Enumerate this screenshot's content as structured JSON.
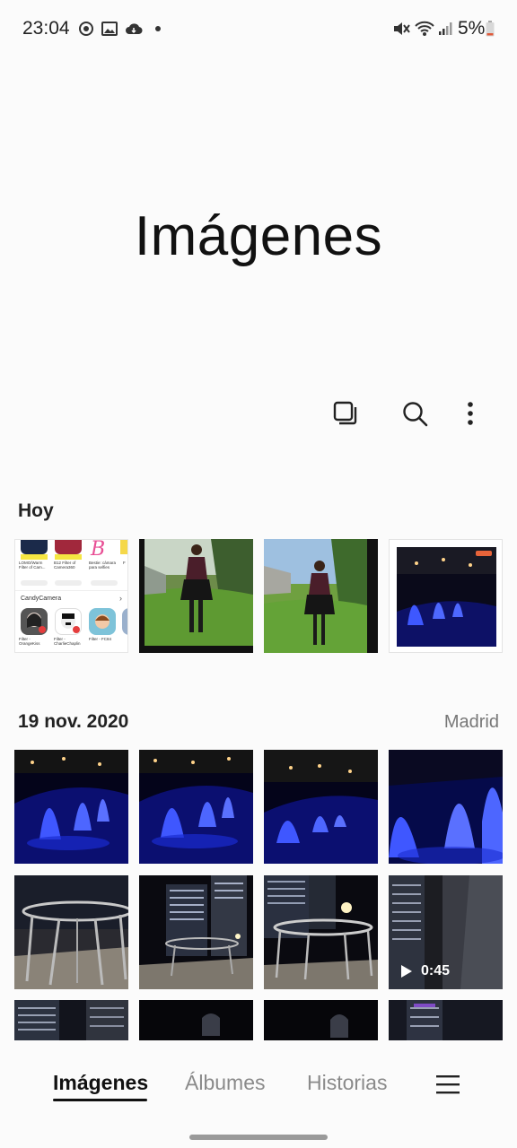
{
  "status_bar": {
    "time": "23:04",
    "battery": "5%",
    "left_icons": [
      "sync-icon",
      "gallery-notification-icon",
      "cloud-icon",
      "dot-icon"
    ],
    "right_icons": [
      "mute-icon",
      "wifi-icon",
      "signal-icon",
      "battery-icon"
    ]
  },
  "header": {
    "title": "Imágenes"
  },
  "toolbar": {
    "icons": [
      "select-icon",
      "search-icon",
      "more-options-icon"
    ]
  },
  "sections": [
    {
      "label": "Hoy",
      "location": ""
    },
    {
      "label": "19 nov. 2020",
      "location": "Madrid"
    }
  ],
  "screenshot_thumb": {
    "app_labels_top": [
      "LOMO/Warm Filter of Cam...",
      "B12 Filter of Camera360",
      "Bestie: cámara para selfies",
      "F"
    ],
    "section_title": "CandyCamera",
    "app_labels_bottom": [
      "Filter - OrangeKiss",
      "Filter - CharlieChaplin",
      "Filter - FC84"
    ]
  },
  "video": {
    "duration": "0:45"
  },
  "bottom_nav": {
    "tabs": [
      "Imágenes",
      "Álbumes",
      "Historias"
    ],
    "active": "Imágenes",
    "menu_icon": "menu-icon"
  },
  "colors": {
    "accent": "#111111",
    "fountain_blue": "#2a3bff",
    "muted_text": "#8a8a8a"
  }
}
